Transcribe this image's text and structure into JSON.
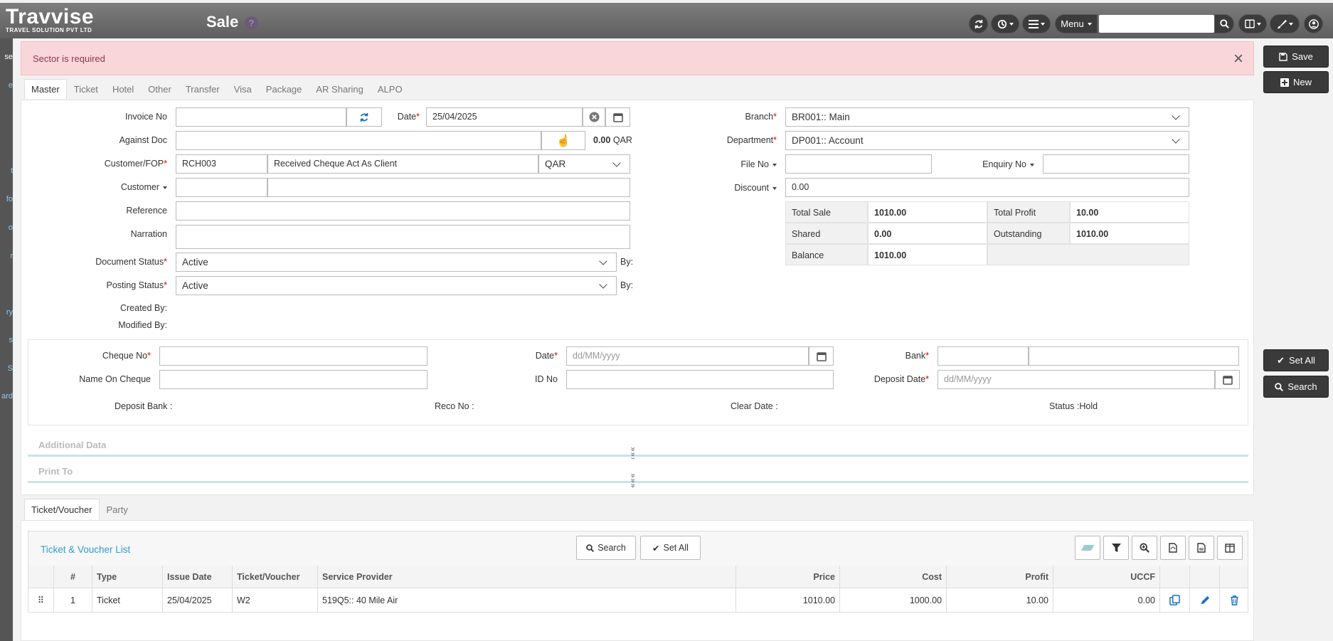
{
  "header": {
    "logo_main": "Travvise",
    "logo_sub": "TRAVEL SOLUTION PVT LTD",
    "page_title": "Sale",
    "help_glyph": "?",
    "menu_label": "Menu",
    "search_placeholder": ""
  },
  "left_strip": [
    "se",
    "e",
    "t",
    "fo",
    "o",
    "r",
    "ry",
    "s",
    "S",
    "ard"
  ],
  "right_panel": {
    "save": "Save",
    "new": "New",
    "set_all": "Set All",
    "search": "Search"
  },
  "alert": {
    "message": "Sector is required",
    "close": "×"
  },
  "tabs": [
    "Master",
    "Ticket",
    "Hotel",
    "Other",
    "Transfer",
    "Visa",
    "Package",
    "AR Sharing",
    "ALPO"
  ],
  "form": {
    "invoice_no": {
      "label": "Invoice No",
      "value": ""
    },
    "date": {
      "label": "Date",
      "value": "25/04/2025"
    },
    "against_doc": {
      "label": "Against Doc",
      "value": "",
      "amount": "0.00",
      "currency": "QAR"
    },
    "customer_fop": {
      "label": "Customer/FOP",
      "code": "RCH003",
      "name": "Received Cheque Act As Client",
      "currency": "QAR"
    },
    "customer": {
      "label": "Customer",
      "code": "",
      "name": ""
    },
    "reference": {
      "label": "Reference",
      "value": ""
    },
    "narration": {
      "label": "Narration",
      "value": ""
    },
    "document_status": {
      "label": "Document Status",
      "value": "Active",
      "by": "By:"
    },
    "posting_status": {
      "label": "Posting Status",
      "value": "Active",
      "by": "By:"
    },
    "created_by": "Created By:",
    "modified_by": "Modified By:",
    "branch": {
      "label": "Branch",
      "value": "BR001:: Main"
    },
    "department": {
      "label": "Department",
      "value": "DP001:: Account"
    },
    "file_no": {
      "label": "File No",
      "value": ""
    },
    "enquiry_no": {
      "label": "Enquiry No",
      "value": ""
    },
    "discount": {
      "label": "Discount",
      "value": "0.00"
    }
  },
  "summary": {
    "total_sale_label": "Total Sale",
    "total_sale": "1010.00",
    "total_profit_label": "Total Profit",
    "total_profit": "10.00",
    "shared_label": "Shared",
    "shared": "0.00",
    "outstanding_label": "Outstanding",
    "outstanding": "1010.00",
    "balance_label": "Balance",
    "balance": "1010.00"
  },
  "cheque": {
    "cheque_no": "Cheque No",
    "name_on_cheque": "Name On Cheque",
    "date": "Date",
    "date_placeholder": "dd/MM/yyyy",
    "id_no": "ID No",
    "bank": "Bank",
    "deposit_date": "Deposit Date",
    "deposit_placeholder": "dd/MM/yyyy",
    "deposit_bank": "Deposit Bank :",
    "reco_no": "Reco No :",
    "clear_date": "Clear Date :",
    "status": "Status :Hold"
  },
  "sections": {
    "additional": "Additional Data",
    "print_to": "Print To",
    "chev": "»»»"
  },
  "list_tabs": [
    "Ticket/Voucher",
    "Party"
  ],
  "list": {
    "title": "Ticket & Voucher List",
    "search": "Search",
    "set_all": "Set All",
    "columns": [
      "#",
      "Type",
      "Issue Date",
      "Ticket/Voucher",
      "Service Provider",
      "Price",
      "Cost",
      "Profit",
      "UCCF"
    ],
    "rows": [
      {
        "no": "1",
        "type": "Ticket",
        "issue_date": "25/04/2025",
        "ticket": "W2",
        "provider": "519Q5:: 40 Mile Air",
        "price": "1010.00",
        "cost": "1000.00",
        "profit": "10.00",
        "uccf": "0.00"
      }
    ]
  },
  "colors": {
    "accent": "#2f9bd8",
    "header": "#6b6b6b",
    "alert_bg": "#f9d6da",
    "icon_blue": "#1a6fc0"
  }
}
